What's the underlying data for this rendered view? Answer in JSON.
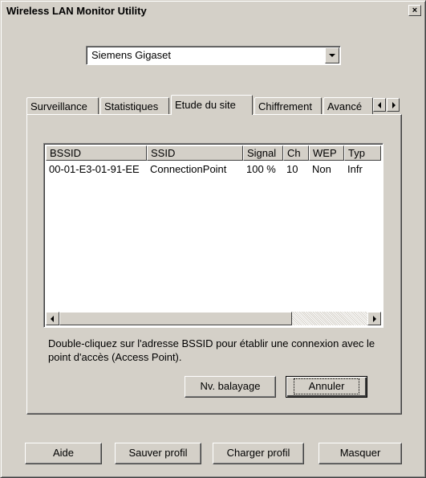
{
  "window": {
    "title": "Wireless LAN Monitor Utility",
    "close_glyph": "×"
  },
  "adapter": {
    "selected": "Siemens Gigaset"
  },
  "tabs": [
    {
      "label": "Surveillance"
    },
    {
      "label": "Statistiques"
    },
    {
      "label": "Etude du site"
    },
    {
      "label": "Chiffrement"
    },
    {
      "label": "Avancé"
    }
  ],
  "site_survey": {
    "columns": [
      "BSSID",
      "SSID",
      "Signal",
      "Ch",
      "WEP",
      "Typ"
    ],
    "rows": [
      [
        "00-01-E3-01-91-EE",
        "ConnectionPoint",
        "100 %",
        "10",
        "Non",
        "Infr"
      ]
    ],
    "hint": "Double-cliquez sur l'adresse BSSID pour établir une connexion avec le point d'accès (Access Point).",
    "rescan_label": "Nv. balayage",
    "cancel_label": "Annuler"
  },
  "footer": {
    "help_label": "Aide",
    "save_profile_label": "Sauver profil",
    "load_profile_label": "Charger profil",
    "hide_label": "Masquer"
  }
}
